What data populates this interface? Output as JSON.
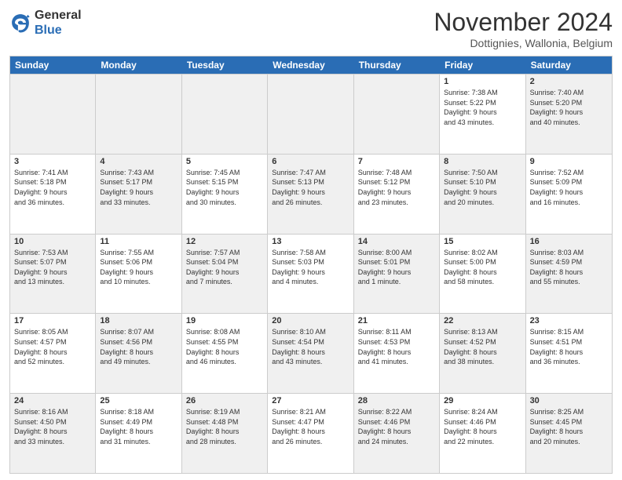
{
  "header": {
    "logo_general": "General",
    "logo_blue": "Blue",
    "month_title": "November 2024",
    "location": "Dottignies, Wallonia, Belgium"
  },
  "weekdays": [
    "Sunday",
    "Monday",
    "Tuesday",
    "Wednesday",
    "Thursday",
    "Friday",
    "Saturday"
  ],
  "weeks": [
    [
      {
        "day": "",
        "info": "",
        "shaded": true
      },
      {
        "day": "",
        "info": "",
        "shaded": true
      },
      {
        "day": "",
        "info": "",
        "shaded": true
      },
      {
        "day": "",
        "info": "",
        "shaded": true
      },
      {
        "day": "",
        "info": "",
        "shaded": true
      },
      {
        "day": "1",
        "info": "Sunrise: 7:38 AM\nSunset: 5:22 PM\nDaylight: 9 hours\nand 43 minutes."
      },
      {
        "day": "2",
        "info": "Sunrise: 7:40 AM\nSunset: 5:20 PM\nDaylight: 9 hours\nand 40 minutes.",
        "shaded": true
      }
    ],
    [
      {
        "day": "3",
        "info": "Sunrise: 7:41 AM\nSunset: 5:18 PM\nDaylight: 9 hours\nand 36 minutes."
      },
      {
        "day": "4",
        "info": "Sunrise: 7:43 AM\nSunset: 5:17 PM\nDaylight: 9 hours\nand 33 minutes.",
        "shaded": true
      },
      {
        "day": "5",
        "info": "Sunrise: 7:45 AM\nSunset: 5:15 PM\nDaylight: 9 hours\nand 30 minutes."
      },
      {
        "day": "6",
        "info": "Sunrise: 7:47 AM\nSunset: 5:13 PM\nDaylight: 9 hours\nand 26 minutes.",
        "shaded": true
      },
      {
        "day": "7",
        "info": "Sunrise: 7:48 AM\nSunset: 5:12 PM\nDaylight: 9 hours\nand 23 minutes."
      },
      {
        "day": "8",
        "info": "Sunrise: 7:50 AM\nSunset: 5:10 PM\nDaylight: 9 hours\nand 20 minutes.",
        "shaded": true
      },
      {
        "day": "9",
        "info": "Sunrise: 7:52 AM\nSunset: 5:09 PM\nDaylight: 9 hours\nand 16 minutes."
      }
    ],
    [
      {
        "day": "10",
        "info": "Sunrise: 7:53 AM\nSunset: 5:07 PM\nDaylight: 9 hours\nand 13 minutes.",
        "shaded": true
      },
      {
        "day": "11",
        "info": "Sunrise: 7:55 AM\nSunset: 5:06 PM\nDaylight: 9 hours\nand 10 minutes."
      },
      {
        "day": "12",
        "info": "Sunrise: 7:57 AM\nSunset: 5:04 PM\nDaylight: 9 hours\nand 7 minutes.",
        "shaded": true
      },
      {
        "day": "13",
        "info": "Sunrise: 7:58 AM\nSunset: 5:03 PM\nDaylight: 9 hours\nand 4 minutes."
      },
      {
        "day": "14",
        "info": "Sunrise: 8:00 AM\nSunset: 5:01 PM\nDaylight: 9 hours\nand 1 minute.",
        "shaded": true
      },
      {
        "day": "15",
        "info": "Sunrise: 8:02 AM\nSunset: 5:00 PM\nDaylight: 8 hours\nand 58 minutes."
      },
      {
        "day": "16",
        "info": "Sunrise: 8:03 AM\nSunset: 4:59 PM\nDaylight: 8 hours\nand 55 minutes.",
        "shaded": true
      }
    ],
    [
      {
        "day": "17",
        "info": "Sunrise: 8:05 AM\nSunset: 4:57 PM\nDaylight: 8 hours\nand 52 minutes."
      },
      {
        "day": "18",
        "info": "Sunrise: 8:07 AM\nSunset: 4:56 PM\nDaylight: 8 hours\nand 49 minutes.",
        "shaded": true
      },
      {
        "day": "19",
        "info": "Sunrise: 8:08 AM\nSunset: 4:55 PM\nDaylight: 8 hours\nand 46 minutes."
      },
      {
        "day": "20",
        "info": "Sunrise: 8:10 AM\nSunset: 4:54 PM\nDaylight: 8 hours\nand 43 minutes.",
        "shaded": true
      },
      {
        "day": "21",
        "info": "Sunrise: 8:11 AM\nSunset: 4:53 PM\nDaylight: 8 hours\nand 41 minutes."
      },
      {
        "day": "22",
        "info": "Sunrise: 8:13 AM\nSunset: 4:52 PM\nDaylight: 8 hours\nand 38 minutes.",
        "shaded": true
      },
      {
        "day": "23",
        "info": "Sunrise: 8:15 AM\nSunset: 4:51 PM\nDaylight: 8 hours\nand 36 minutes."
      }
    ],
    [
      {
        "day": "24",
        "info": "Sunrise: 8:16 AM\nSunset: 4:50 PM\nDaylight: 8 hours\nand 33 minutes.",
        "shaded": true
      },
      {
        "day": "25",
        "info": "Sunrise: 8:18 AM\nSunset: 4:49 PM\nDaylight: 8 hours\nand 31 minutes."
      },
      {
        "day": "26",
        "info": "Sunrise: 8:19 AM\nSunset: 4:48 PM\nDaylight: 8 hours\nand 28 minutes.",
        "shaded": true
      },
      {
        "day": "27",
        "info": "Sunrise: 8:21 AM\nSunset: 4:47 PM\nDaylight: 8 hours\nand 26 minutes."
      },
      {
        "day": "28",
        "info": "Sunrise: 8:22 AM\nSunset: 4:46 PM\nDaylight: 8 hours\nand 24 minutes.",
        "shaded": true
      },
      {
        "day": "29",
        "info": "Sunrise: 8:24 AM\nSunset: 4:46 PM\nDaylight: 8 hours\nand 22 minutes."
      },
      {
        "day": "30",
        "info": "Sunrise: 8:25 AM\nSunset: 4:45 PM\nDaylight: 8 hours\nand 20 minutes.",
        "shaded": true
      }
    ]
  ]
}
